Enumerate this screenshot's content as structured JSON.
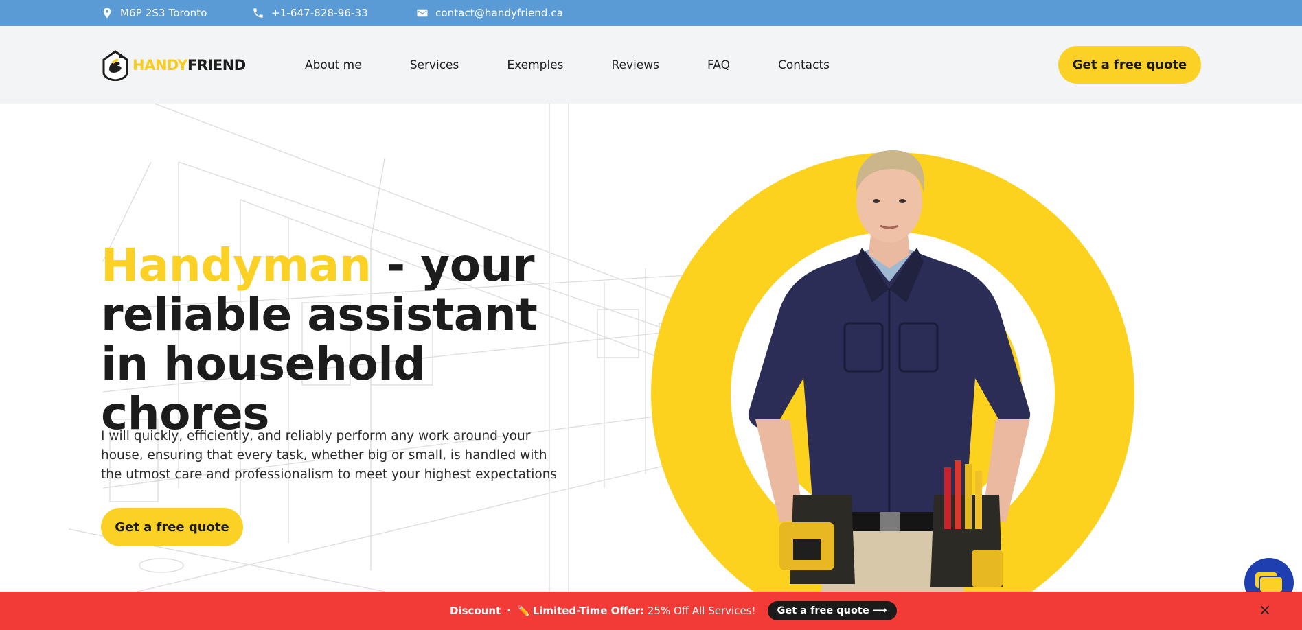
{
  "topbar": {
    "address": "M6P 2S3 Toronto",
    "phone": "+1-647-828-96-33",
    "email": "contact@handyfriend.ca",
    "icons": [
      "location-pin-icon",
      "phone-icon",
      "envelope-icon"
    ]
  },
  "header": {
    "logo": {
      "part1": "HANDY",
      "part2": "FRIEND"
    },
    "nav": [
      "About me",
      "Services",
      "Exemples",
      "Reviews",
      "FAQ",
      "Contacts"
    ],
    "cta_label": "Get a free quote"
  },
  "hero": {
    "title_accent": "Handyman",
    "title_rest": " - your reliable assistant in household chores",
    "description": "I will quickly, efficiently, and reliably perform any work around your house, ensuring that every task, whether big or small, is handled with the utmost care and professionalism to meet your highest expectations",
    "cta_label": "Get a free quote"
  },
  "promo": {
    "label": "Discount",
    "separator": "·",
    "offer_icon": "✏️",
    "offer_strong": "Limited-Time Offer:",
    "offer_text": " 25% Off All Services!",
    "button_label": "Get a free quote ⟶",
    "close_label": "×"
  },
  "colors": {
    "topbar": "#5b9bd5",
    "accent": "#fbd126",
    "promo": "#f23a36",
    "chat": "#1f3fb0"
  }
}
